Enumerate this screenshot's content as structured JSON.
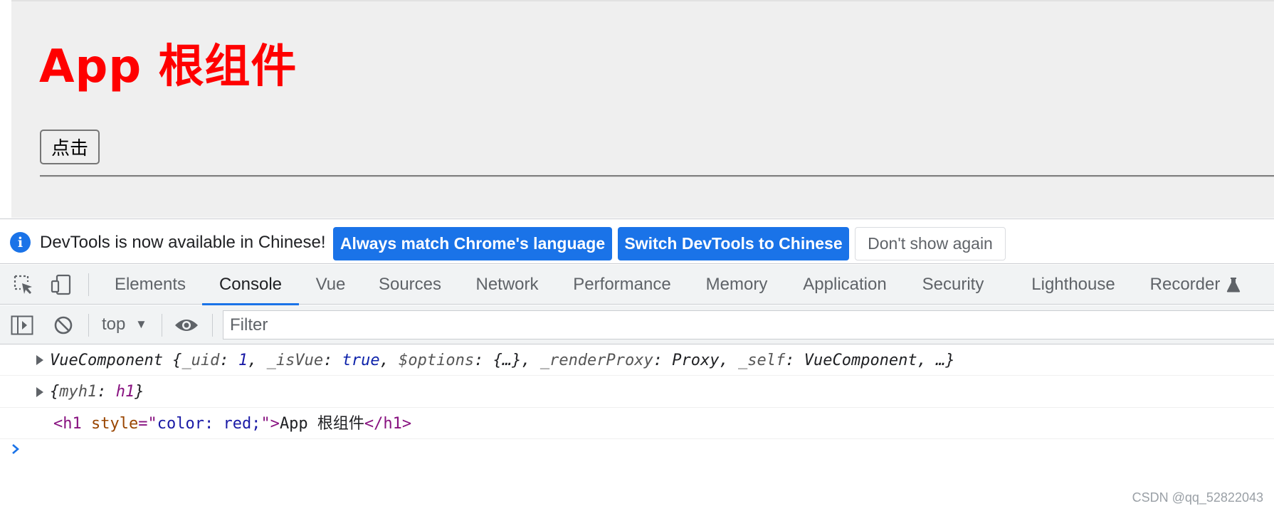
{
  "app": {
    "title": "App 根组件",
    "button_label": "点击",
    "title_color": "#ff0000"
  },
  "infobar": {
    "icon": "info-icon",
    "message": "DevTools is now available in Chinese!",
    "buttons": {
      "always_match": "Always match Chrome's language",
      "switch": "Switch DevTools to Chinese",
      "dont_show": "Don't show again"
    }
  },
  "devtools": {
    "tool_icons": [
      "inspect-element-icon",
      "device-toolbar-icon"
    ],
    "tabs": [
      "Elements",
      "Console",
      "Vue",
      "Sources",
      "Network",
      "Performance",
      "Memory",
      "Application",
      "Security",
      "Lighthouse",
      "Recorder"
    ],
    "active_tab": "Console",
    "recorder_icon": "flask-icon",
    "accent_color": "#1a73e8"
  },
  "console_toolbar": {
    "context": "top",
    "filter_placeholder": "Filter",
    "icons": [
      "show-sidebar-icon",
      "clear-console-icon",
      "live-expression-eye-icon"
    ]
  },
  "console": {
    "messages": [
      {
        "parts": [
          "VueComponent {",
          "_uid",
          ": ",
          "1",
          ", ",
          "_isVue",
          ": ",
          "true",
          ", ",
          "$options",
          ": {…}, ",
          "_renderProxy",
          ": Proxy, ",
          "_self",
          ": VueComponent, …}"
        ]
      },
      {
        "parts": [
          "{",
          "myh1",
          ": ",
          "h1",
          "}"
        ]
      },
      {
        "parts": [
          "<h1",
          " style",
          "=\"",
          "color: red;",
          "\">",
          "App 根组件",
          "</h1>"
        ]
      }
    ]
  },
  "watermark": "CSDN @qq_52822043"
}
